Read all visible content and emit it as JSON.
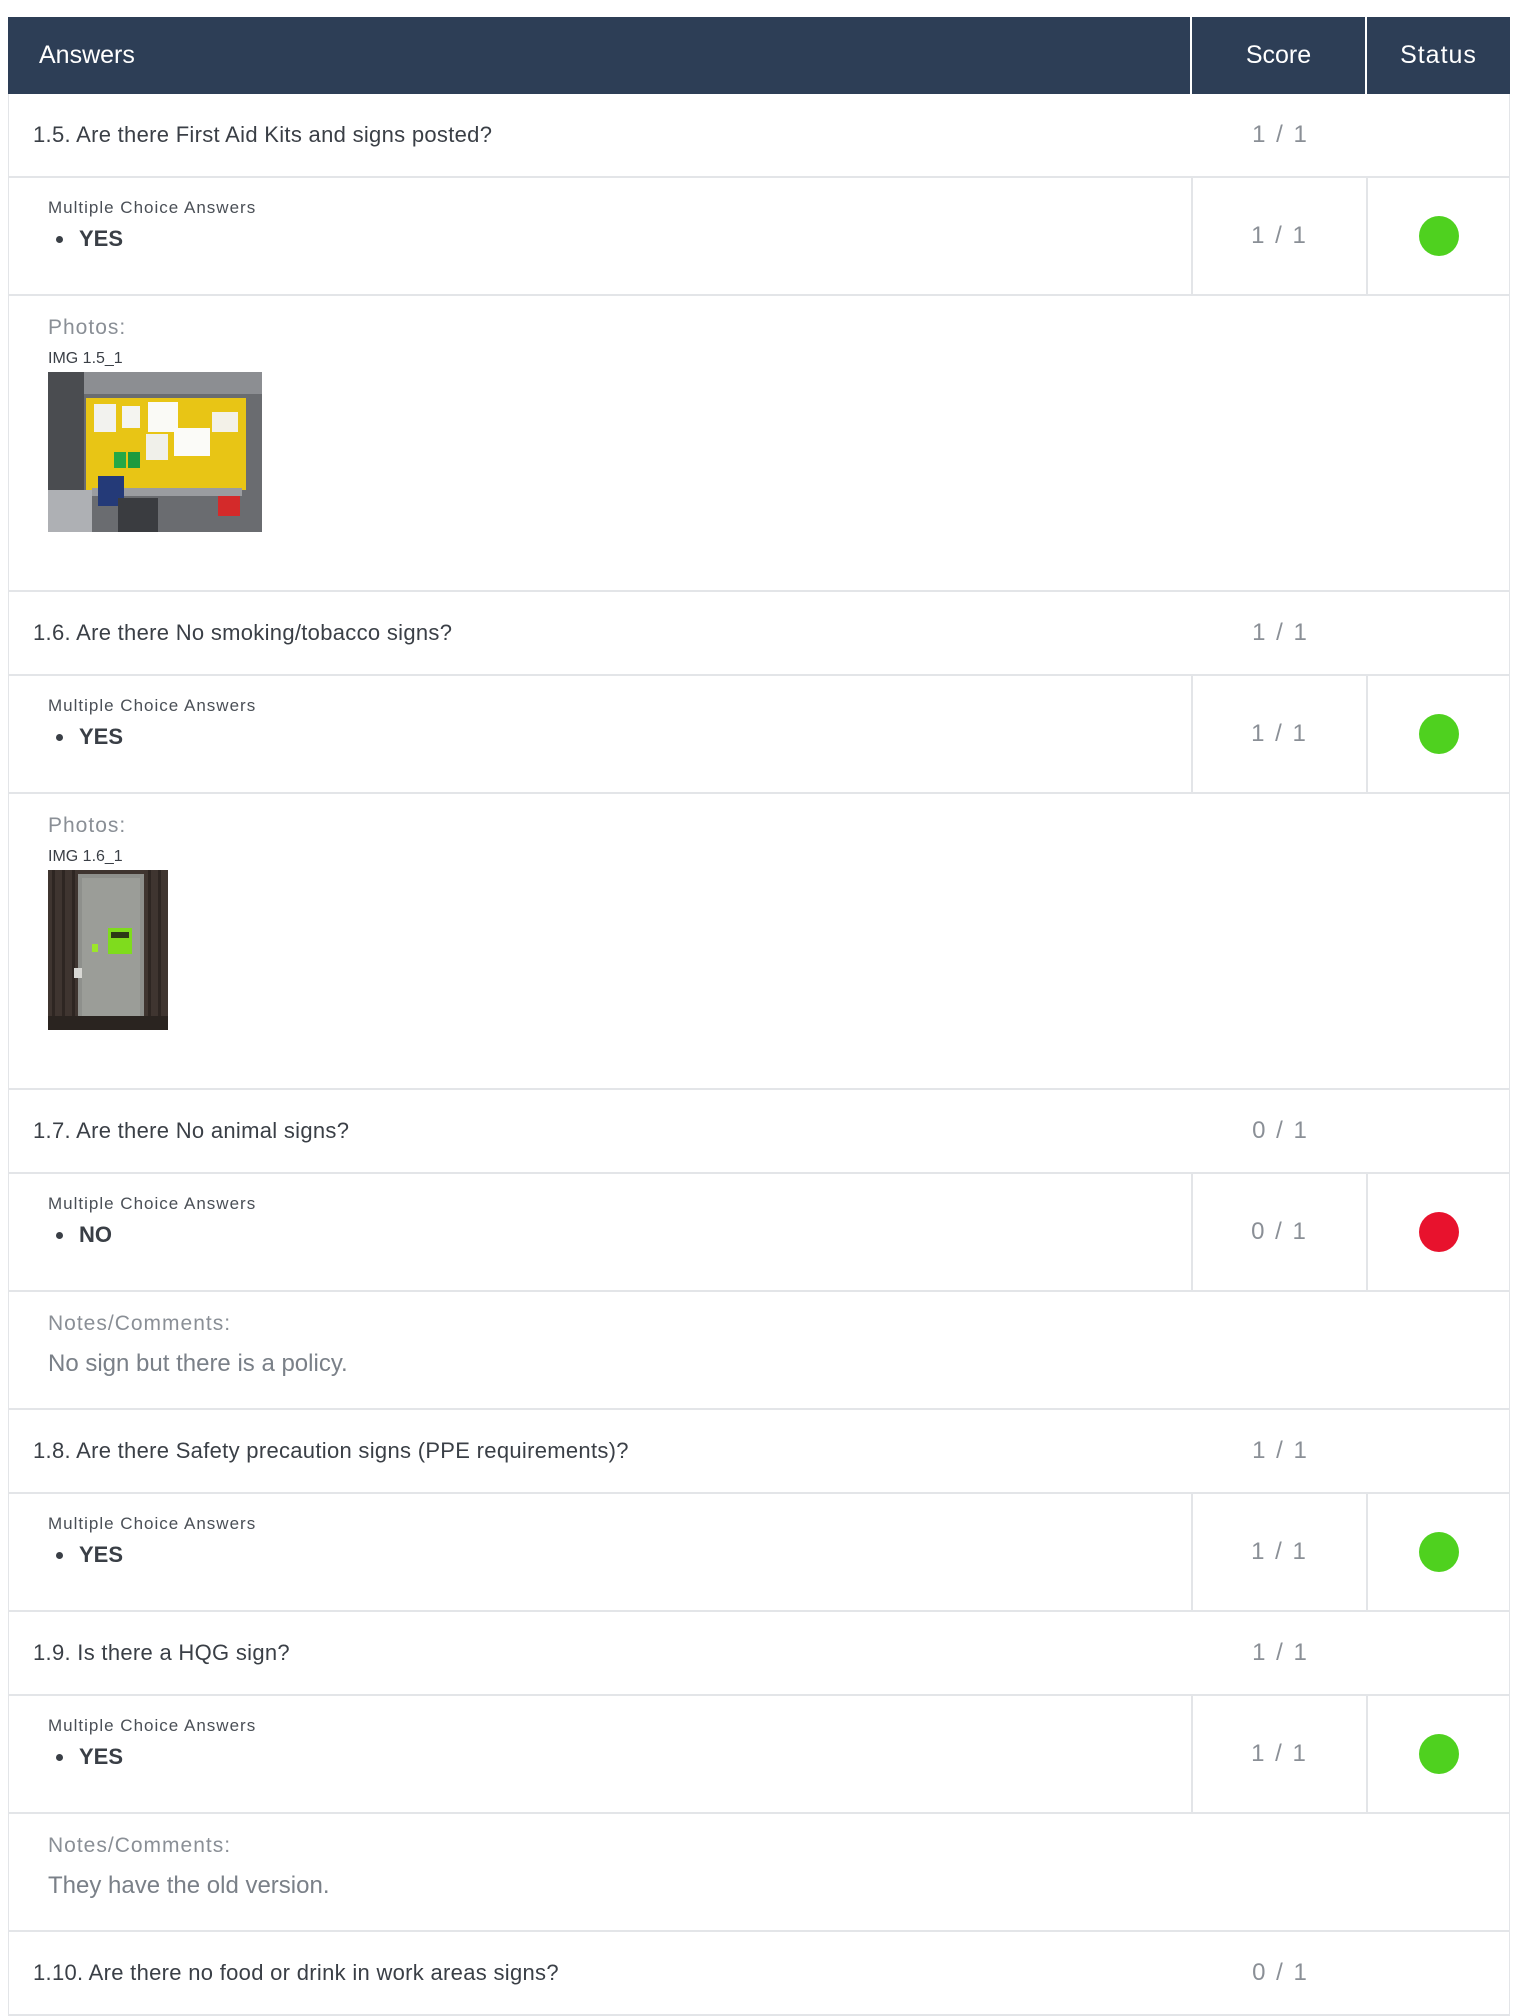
{
  "header": {
    "answers_label": "Answers",
    "score_label": "Score",
    "status_label": "Status"
  },
  "multiple_choice_label": "Multiple Choice Answers",
  "photos_label": "Photos:",
  "notes_label": "Notes/Comments:",
  "status_colors": {
    "pass": "#4fd11f",
    "fail": "#e8122d"
  },
  "items": [
    {
      "question": "1.5. Are there First Aid Kits and signs posted?",
      "question_score": "1 / 1",
      "answer": "YES",
      "answer_score": "1 / 1",
      "status": "pass",
      "photo_caption": "IMG 1.5_1"
    },
    {
      "question": "1.6. Are there No smoking/tobacco signs?",
      "question_score": "1 / 1",
      "answer": "YES",
      "answer_score": "1 / 1",
      "status": "pass",
      "photo_caption": "IMG 1.6_1"
    },
    {
      "question": "1.7. Are there No animal signs?",
      "question_score": "0 / 1",
      "answer": "NO",
      "answer_score": "0 / 1",
      "status": "fail",
      "note": "No sign but there is a policy."
    },
    {
      "question": "1.8. Are there Safety precaution signs (PPE requirements)?",
      "question_score": "1 / 1",
      "answer": "YES",
      "answer_score": "1 / 1",
      "status": "pass"
    },
    {
      "question": "1.9. Is there a HQG sign?",
      "question_score": "1 / 1",
      "answer": "YES",
      "answer_score": "1 / 1",
      "status": "pass",
      "note": "They have the old version."
    },
    {
      "question": "1.10. Are there no food or drink in work areas signs?",
      "question_score": "0 / 1"
    }
  ]
}
